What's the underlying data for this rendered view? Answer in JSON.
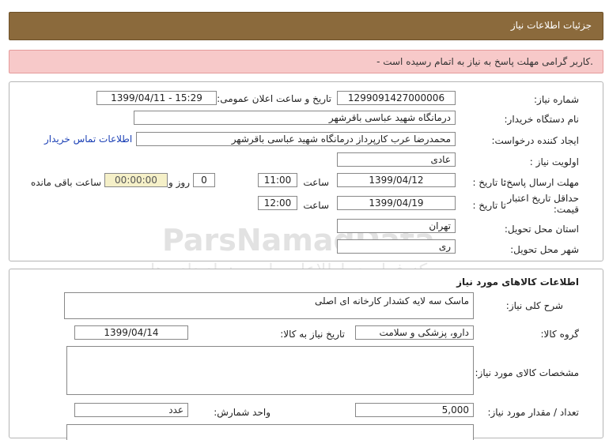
{
  "header": {
    "title": "جزئیات اطلاعات نیاز"
  },
  "alert": {
    "message": "- کاربر گرامی مهلت پاسخ به نیاز به اتمام رسیده است."
  },
  "watermark": {
    "brand": "ParsNamadData",
    "line1": "مرکز فراوری اطلاعات پارس نماد داده ها",
    "line2": "پیگاه اطلاع رسانی مناقصه ومزایده",
    "phone": "۰۲۱-۸۸۳۴۹۶۷۰-۹"
  },
  "info": {
    "need_number_label": "شماره نیاز:",
    "need_number": "1299091427000006",
    "announce_label": "تاریخ و ساعت اعلان عمومی:",
    "announce_value": "1399/04/11 - 15:29",
    "buyer_label": "نام دستگاه خریدار:",
    "buyer_value": "درمانگاه شهید عباسی باقرشهر",
    "creator_label": "ایجاد کننده درخواست:",
    "creator_value": "محمدرضا عرب کارپرداز درمانگاه شهید عباسی باقرشهر",
    "contact_link": "اطلاعات تماس خریدار",
    "priority_label": "اولویت نیاز :",
    "priority_value": "عادی",
    "deadline_label": "مهلت ارسال پاسخ:",
    "to_date_label": "تا تاریخ :",
    "deadline_date": "1399/04/12",
    "time_label": "ساعت",
    "deadline_time": "11:00",
    "days_value": "0",
    "days_label": "روز و",
    "remaining_time": "00:00:00",
    "remaining_label": "ساعت باقی مانده",
    "validity_label_1": "حداقل تاریخ اعتبار",
    "validity_label_2": "قیمت:",
    "validity_date": "1399/04/19",
    "validity_time": "12:00",
    "province_label": "استان محل تحویل:",
    "province_value": "تهران",
    "city_label": "شهر محل تحویل:",
    "city_value": "ری"
  },
  "goods": {
    "section_title": "اطلاعات کالاهای مورد نیاز",
    "summary_label": "شرح کلی نیاز:",
    "summary_value": "ماسک سه لایه کشدار کارخانه ای اصلی",
    "group_label": "گروه کالا:",
    "group_value": "دارو، پزشکی و سلامت",
    "need_date_label": "تاریخ نیاز به کالا:",
    "need_date_value": "1399/04/14",
    "specs_label": "مشخصات کالای مورد نیاز:",
    "specs_value": "",
    "qty_label": "تعداد / مقدار مورد نیاز:",
    "qty_value": "5,000",
    "unit_label": "واحد شمارش:",
    "unit_value": "عدد"
  }
}
